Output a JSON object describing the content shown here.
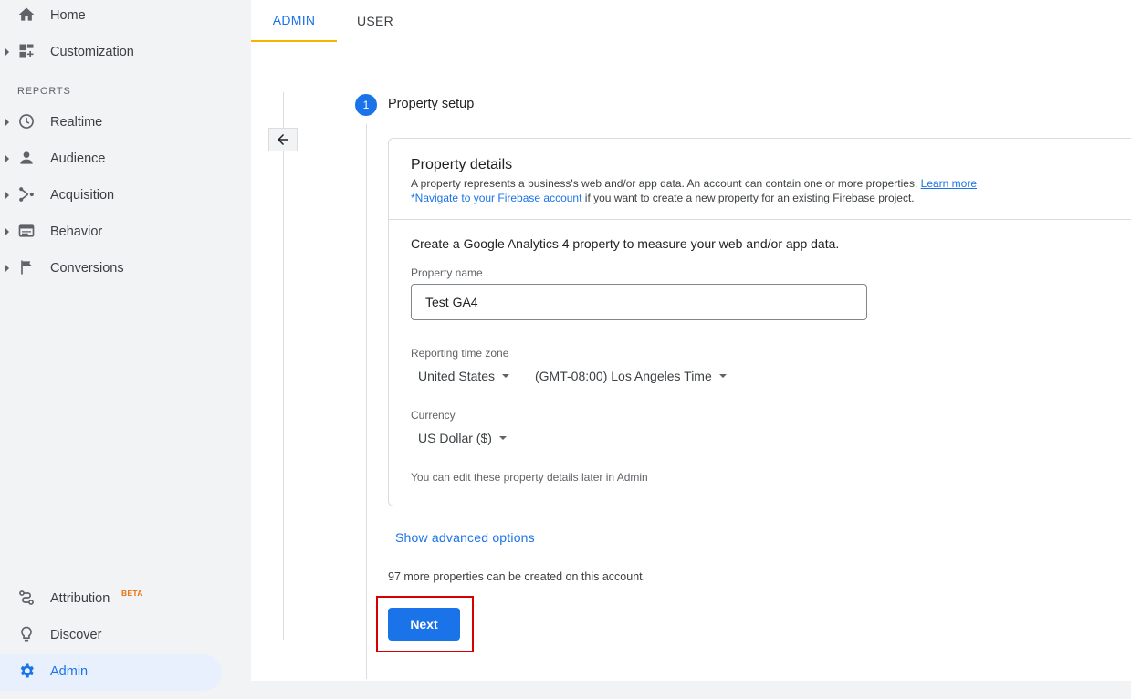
{
  "sidebar": {
    "top_items": [
      {
        "label": "Home",
        "icon": "home-icon"
      },
      {
        "label": "Customization",
        "icon": "dashboard-icon"
      }
    ],
    "reports_label": "REPORTS",
    "report_items": [
      {
        "label": "Realtime",
        "icon": "clock-icon"
      },
      {
        "label": "Audience",
        "icon": "person-icon"
      },
      {
        "label": "Acquisition",
        "icon": "acquisition-icon"
      },
      {
        "label": "Behavior",
        "icon": "behavior-icon"
      },
      {
        "label": "Conversions",
        "icon": "flag-icon"
      }
    ],
    "bottom_items": [
      {
        "label": "Attribution",
        "badge": "BETA",
        "icon": "attribution-icon"
      },
      {
        "label": "Discover",
        "icon": "lightbulb-icon"
      },
      {
        "label": "Admin",
        "icon": "gear-icon",
        "active": true
      }
    ]
  },
  "tabs": [
    {
      "label": "ADMIN",
      "active": true
    },
    {
      "label": "USER",
      "active": false
    }
  ],
  "step": {
    "number": "1",
    "title": "Property setup"
  },
  "card": {
    "title": "Property details",
    "desc_line1": "A property represents a business's web and/or app data. An account can contain one or more properties. ",
    "learn_more": "Learn more",
    "firebase_link": "*Navigate to your Firebase account",
    "desc_line2_rest": " if you want to create a new property for an existing Firebase project.",
    "create_text": "Create a Google Analytics 4 property to measure your web and/or app data.",
    "property_name_label": "Property name",
    "property_name_value": "Test GA4",
    "timezone_label": "Reporting time zone",
    "country_value": "United States",
    "timezone_value": "(GMT-08:00) Los Angeles Time",
    "currency_label": "Currency",
    "currency_value": "US Dollar ($)",
    "edit_note": "You can edit these property details later in Admin"
  },
  "advanced_link": "Show advanced options",
  "more_properties": "97 more properties can be created on this account.",
  "next_label": "Next",
  "colors": {
    "accent": "#1a73e8",
    "tab_underline": "#f4b400",
    "highlight_box": "#d50000",
    "beta": "#e8710a"
  }
}
